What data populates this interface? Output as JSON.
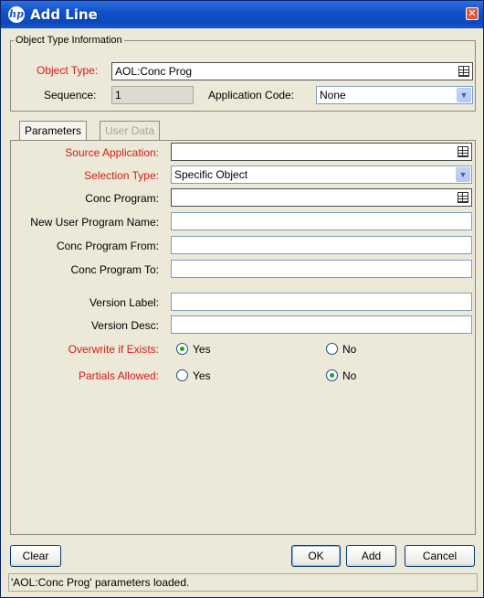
{
  "window": {
    "title": "Add Line",
    "close_glyph": "✕"
  },
  "object_type_info": {
    "legend": "Object Type Information",
    "object_type_label": "Object Type:",
    "object_type_value": "AOL:Conc Prog",
    "sequence_label": "Sequence:",
    "sequence_value": "1",
    "app_code_label": "Application Code:",
    "app_code_value": "None"
  },
  "tabs": [
    {
      "label": "Parameters"
    },
    {
      "label": "User Data"
    }
  ],
  "params": {
    "source_application_label": "Source Application:",
    "source_application_value": "",
    "selection_type_label": "Selection Type:",
    "selection_type_value": "Specific Object",
    "conc_program_label": "Conc Program:",
    "conc_program_value": "",
    "new_user_program_name_label": "New User Program Name:",
    "new_user_program_name_value": "",
    "conc_program_from_label": "Conc Program From:",
    "conc_program_from_value": "",
    "conc_program_to_label": "Conc Program To:",
    "conc_program_to_value": "",
    "version_label_label": "Version Label:",
    "version_label_value": "",
    "version_desc_label": "Version Desc:",
    "version_desc_value": "",
    "overwrite_label": "Overwrite if Exists:",
    "overwrite_selected": "Yes",
    "partials_label": "Partials Allowed:",
    "partials_selected": "No",
    "yes_label": "Yes",
    "no_label": "No"
  },
  "buttons": {
    "clear": "Clear",
    "ok": "OK",
    "add": "Add",
    "cancel": "Cancel"
  },
  "status_text": "'AOL:Conc Prog' parameters loaded.",
  "colors": {
    "required_label": "#d41a1a",
    "titlebar": "#1152c9",
    "radio_selected": "#21a121"
  }
}
